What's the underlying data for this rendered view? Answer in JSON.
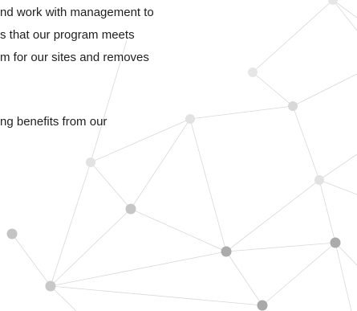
{
  "paragraph": {
    "lines": [
      "nd work with management to",
      "s that our program meets",
      "m for our sites and removes",
      "ng benefits from our"
    ]
  },
  "decoration": {
    "style": "network-node-graphic",
    "node_color_light": "#e6e6e6",
    "node_color_mid": "#c8c8c8",
    "node_color_dark": "#a9a9a9",
    "edge_color": "#d9d9d9"
  }
}
